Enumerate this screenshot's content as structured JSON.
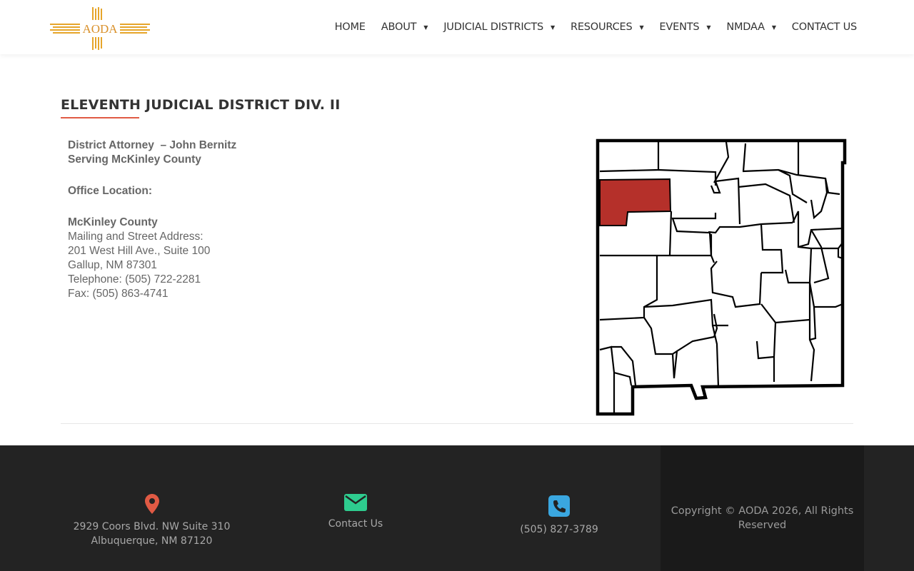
{
  "header": {
    "logo_text": "AODA",
    "nav": [
      {
        "label": "HOME",
        "dropdown": false
      },
      {
        "label": "ABOUT",
        "dropdown": true
      },
      {
        "label": "JUDICIAL DISTRICTS",
        "dropdown": true
      },
      {
        "label": "RESOURCES",
        "dropdown": true
      },
      {
        "label": "EVENTS",
        "dropdown": true
      },
      {
        "label": "NMDAA",
        "dropdown": true
      },
      {
        "label": "CONTACT US",
        "dropdown": false
      }
    ]
  },
  "main": {
    "title": "ELEVENTH JUDICIAL DISTRICT DIV. II",
    "district_attorney": "District Attorney  – John Bernitz",
    "serving": "Serving McKinley County",
    "office_location_label": "Office Location:",
    "county": "McKinley County",
    "address_label": "Mailing and Street Address:",
    "street": "201 West Hill Ave., Suite 100",
    "city": "Gallup, NM 87301",
    "telephone": "Telephone: (505) 722-2281",
    "fax": "Fax: (505) 863-4741",
    "map": {
      "highlight_color": "#b5302a",
      "highlighted_county": "McKinley County"
    }
  },
  "footer": {
    "address_line1": "2929 Coors Blvd. NW Suite 310",
    "address_line2": "Albuquerque, NM 87120",
    "contact_label": "Contact Us",
    "phone": "(505) 827-3789",
    "copyright": "Copyright © AODA 2026, All Rights Reserved",
    "colors": {
      "location": "#e05a44",
      "mail": "#2ecc8f",
      "phone": "#3aa7e0"
    }
  }
}
